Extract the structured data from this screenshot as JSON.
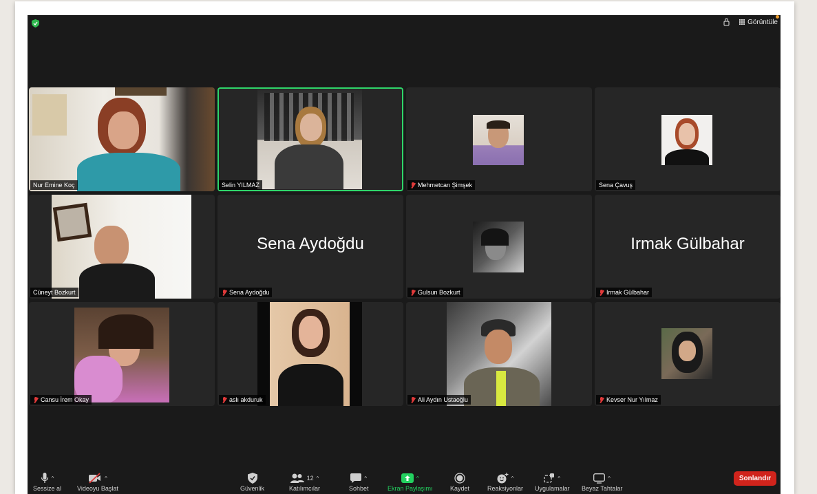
{
  "topbar": {
    "view_label": "Görüntüle"
  },
  "participants": [
    {
      "name": "Nur Emine Koç",
      "muted": false,
      "video": true
    },
    {
      "name": "Selin YILMAZ",
      "muted": false,
      "video": true,
      "active_speaker": true
    },
    {
      "name": "Mehmetcan Şimşek",
      "muted": true,
      "video": true
    },
    {
      "name": "Sena Çavuş",
      "muted": false,
      "video": true
    },
    {
      "name": "Cüneyt Bozkurt",
      "muted": false,
      "video": true
    },
    {
      "name": "Sena Aydoğdu",
      "muted": true,
      "video": false,
      "display_name": "Sena Aydoğdu"
    },
    {
      "name": "Gulsun Bozkurt",
      "muted": true,
      "video": true
    },
    {
      "name": "Irmak Gülbahar",
      "muted": true,
      "video": false,
      "display_name": "Irmak Gülbahar"
    },
    {
      "name": "Cansu İrem Okay",
      "muted": true,
      "video": true
    },
    {
      "name": "aslı akduruk",
      "muted": true,
      "video": true
    },
    {
      "name": "Ali Aydın Ustaoğlu",
      "muted": true,
      "video": true
    },
    {
      "name": "Kevser Nur Yılmaz",
      "muted": true,
      "video": true
    }
  ],
  "toolbar": {
    "mute": "Sessize al",
    "video": "Videoyu Başlat",
    "security": "Güvenlik",
    "participants": "Katılımcılar",
    "participants_count": "12",
    "chat": "Sohbet",
    "share": "Ekran Paylaşımı",
    "record": "Kaydet",
    "reactions": "Reaksiyonlar",
    "apps": "Uygulamalar",
    "whiteboard": "Beyaz Tahtalar",
    "end": "Sonlandır"
  },
  "colors": {
    "active_border": "#2fd66a",
    "share_green": "#23d160",
    "end_red": "#d0241c",
    "muted_red": "#e03a3a"
  }
}
